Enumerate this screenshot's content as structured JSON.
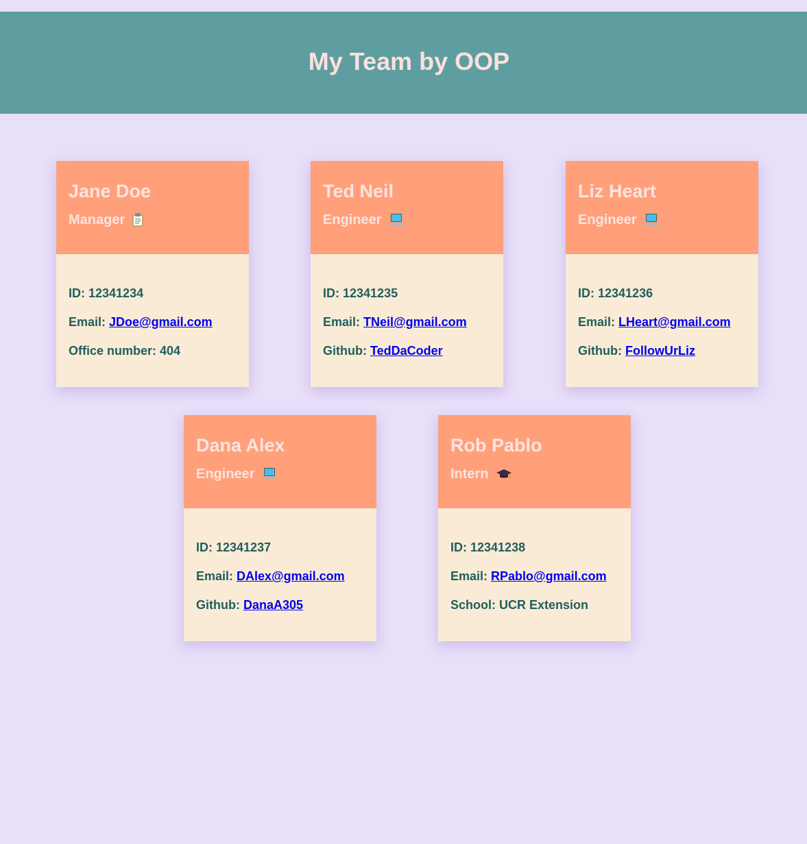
{
  "header": {
    "title": "My Team by OOP"
  },
  "labels": {
    "id": "ID: ",
    "email": "Email: ",
    "office": "Office number: ",
    "github": "Github: ",
    "school": "School: "
  },
  "cards": [
    {
      "name": "Jane Doe",
      "role": "Manager",
      "icon": "clipboard-icon",
      "id": "12341234",
      "email": "JDoe@gmail.com",
      "office": "404"
    },
    {
      "name": "Ted Neil",
      "role": "Engineer",
      "icon": "laptop-icon",
      "id": "12341235",
      "email": "TNeil@gmail.com",
      "github": "TedDaCoder"
    },
    {
      "name": "Liz Heart",
      "role": "Engineer",
      "icon": "laptop-icon",
      "id": "12341236",
      "email": "LHeart@gmail.com",
      "github": "FollowUrLiz"
    },
    {
      "name": "Dana Alex",
      "role": "Engineer",
      "icon": "laptop-icon",
      "id": "12341237",
      "email": "DAlex@gmail.com",
      "github": "DanaA305"
    },
    {
      "name": "Rob Pablo",
      "role": "Intern",
      "icon": "graduation-cap-icon",
      "id": "12341238",
      "email": "RPablo@gmail.com",
      "school": "UCR Extension"
    }
  ],
  "colors": {
    "background": "#e8dffa",
    "header": "#5f9ea0",
    "card_head": "#ffa07a",
    "card_body": "#faebd7",
    "text": "#1f5f5b",
    "link": "#0000ee"
  }
}
